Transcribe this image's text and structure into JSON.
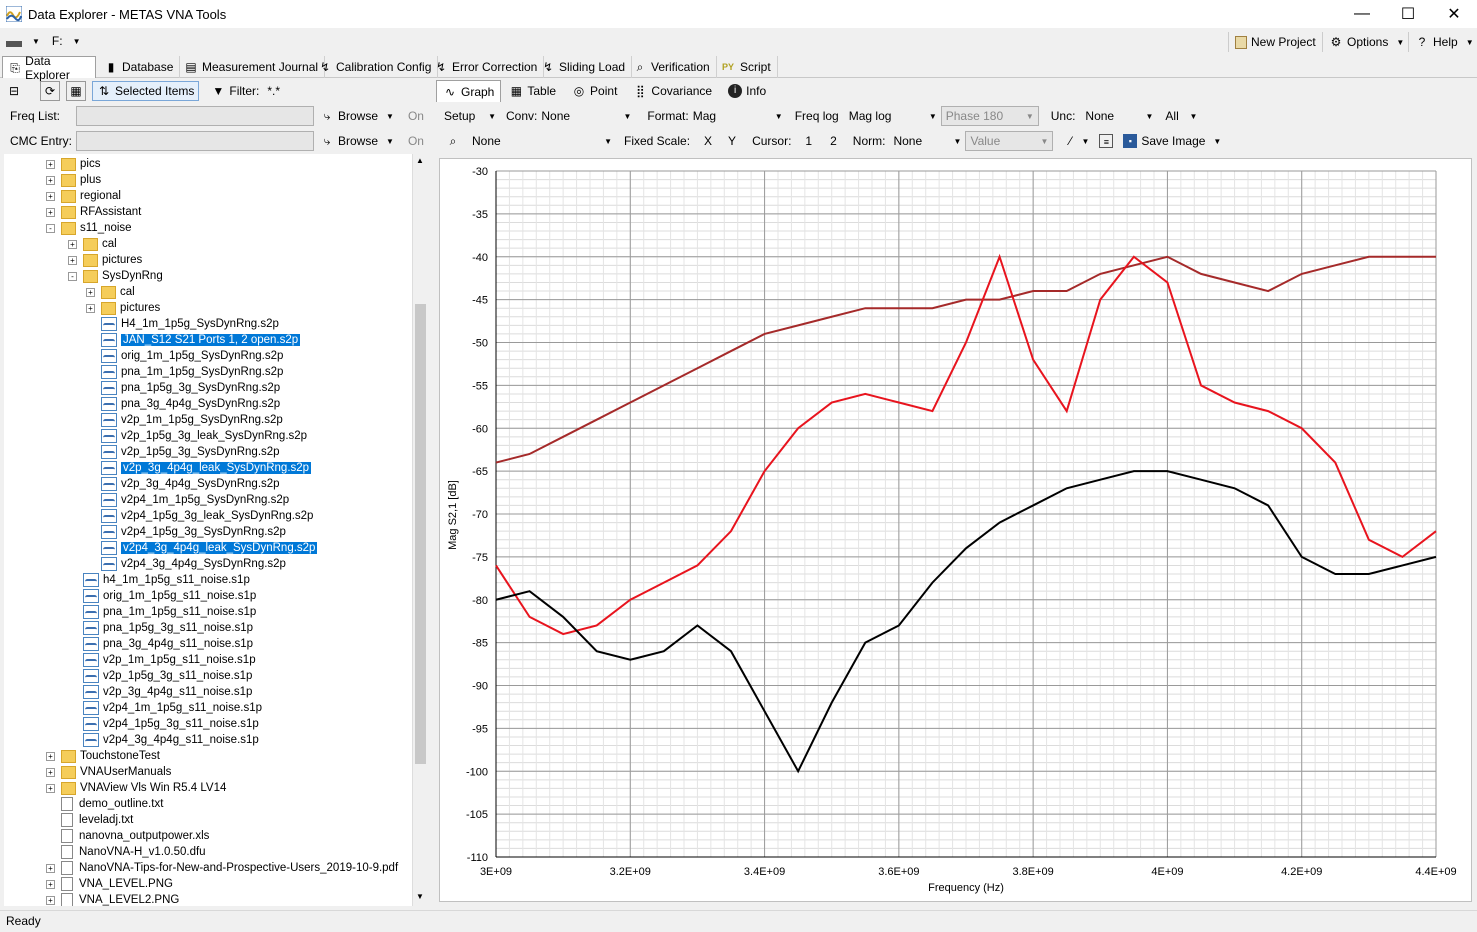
{
  "window": {
    "title": "Data Explorer - METAS VNA Tools",
    "minimize": "—",
    "maximize": "☐",
    "close": "✕"
  },
  "menubar": {
    "drive": "F:",
    "new_project": "New Project",
    "options": "Options",
    "help": "Help"
  },
  "top_tabs": [
    "Data Explorer",
    "Database",
    "Measurement Journal",
    "Calibration Config",
    "Error Correction",
    "Sliding Load",
    "Verification",
    "Script"
  ],
  "left_toolbar": {
    "selected_items": "Selected Items",
    "filter_label": "Filter:",
    "filter_value": "*.*",
    "freq_list_label": "Freq List:",
    "cmc_entry_label": "CMC Entry:",
    "browse": "Browse",
    "on": "On"
  },
  "tree": [
    {
      "label": "pics",
      "type": "folder",
      "level": 2,
      "expander": "+"
    },
    {
      "label": "plus",
      "type": "folder",
      "level": 2,
      "expander": "+"
    },
    {
      "label": "regional",
      "type": "folder",
      "level": 2,
      "expander": "+"
    },
    {
      "label": "RFAssistant",
      "type": "folder",
      "level": 2,
      "expander": "+"
    },
    {
      "label": "s11_noise",
      "type": "folder",
      "level": 2,
      "expander": "-"
    },
    {
      "label": "cal",
      "type": "folder",
      "level": 3,
      "expander": "+"
    },
    {
      "label": "pictures",
      "type": "folder",
      "level": 3,
      "expander": "+"
    },
    {
      "label": "SysDynRng",
      "type": "folder",
      "level": 3,
      "expander": "-"
    },
    {
      "label": "cal",
      "type": "folder",
      "level": 4,
      "expander": "+"
    },
    {
      "label": "pictures",
      "type": "folder",
      "level": 4,
      "expander": "+"
    },
    {
      "label": "H4_1m_1p5g_SysDynRng.s2p",
      "type": "s2p",
      "level": 4
    },
    {
      "label": "JAN_S12 S21 Ports 1, 2 open.s2p",
      "type": "s2p",
      "level": 4,
      "selected": true
    },
    {
      "label": "orig_1m_1p5g_SysDynRng.s2p",
      "type": "s2p",
      "level": 4
    },
    {
      "label": "pna_1m_1p5g_SysDynRng.s2p",
      "type": "s2p",
      "level": 4
    },
    {
      "label": "pna_1p5g_3g_SysDynRng.s2p",
      "type": "s2p",
      "level": 4
    },
    {
      "label": "pna_3g_4p4g_SysDynRng.s2p",
      "type": "s2p",
      "level": 4
    },
    {
      "label": "v2p_1m_1p5g_SysDynRng.s2p",
      "type": "s2p",
      "level": 4
    },
    {
      "label": "v2p_1p5g_3g_leak_SysDynRng.s2p",
      "type": "s2p",
      "level": 4
    },
    {
      "label": "v2p_1p5g_3g_SysDynRng.s2p",
      "type": "s2p",
      "level": 4
    },
    {
      "label": "v2p_3g_4p4g_leak_SysDynRng.s2p",
      "type": "s2p",
      "level": 4,
      "selected": true
    },
    {
      "label": "v2p_3g_4p4g_SysDynRng.s2p",
      "type": "s2p",
      "level": 4
    },
    {
      "label": "v2p4_1m_1p5g_SysDynRng.s2p",
      "type": "s2p",
      "level": 4
    },
    {
      "label": "v2p4_1p5g_3g_leak_SysDynRng.s2p",
      "type": "s2p",
      "level": 4
    },
    {
      "label": "v2p4_1p5g_3g_SysDynRng.s2p",
      "type": "s2p",
      "level": 4
    },
    {
      "label": "v2p4_3g_4p4g_leak_SysDynRng.s2p",
      "type": "s2p",
      "level": 4,
      "selected": true
    },
    {
      "label": "v2p4_3g_4p4g_SysDynRng.s2p",
      "type": "s2p",
      "level": 4
    },
    {
      "label": "h4_1m_1p5g_s11_noise.s1p",
      "type": "s1p",
      "level": 3
    },
    {
      "label": "orig_1m_1p5g_s11_noise.s1p",
      "type": "s1p",
      "level": 3
    },
    {
      "label": "pna_1m_1p5g_s11_noise.s1p",
      "type": "s1p",
      "level": 3
    },
    {
      "label": "pna_1p5g_3g_s11_noise.s1p",
      "type": "s1p",
      "level": 3
    },
    {
      "label": "pna_3g_4p4g_s11_noise.s1p",
      "type": "s1p",
      "level": 3
    },
    {
      "label": "v2p_1m_1p5g_s11_noise.s1p",
      "type": "s1p",
      "level": 3
    },
    {
      "label": "v2p_1p5g_3g_s11_noise.s1p",
      "type": "s1p",
      "level": 3
    },
    {
      "label": "v2p_3g_4p4g_s11_noise.s1p",
      "type": "s1p",
      "level": 3
    },
    {
      "label": "v2p4_1m_1p5g_s11_noise.s1p",
      "type": "s1p",
      "level": 3
    },
    {
      "label": "v2p4_1p5g_3g_s11_noise.s1p",
      "type": "s1p",
      "level": 3
    },
    {
      "label": "v2p4_3g_4p4g_s11_noise.s1p",
      "type": "s1p",
      "level": 3
    },
    {
      "label": "TouchstoneTest",
      "type": "folder",
      "level": 2,
      "expander": "+"
    },
    {
      "label": "VNAUserManuals",
      "type": "folder",
      "level": 2,
      "expander": "+"
    },
    {
      "label": "VNAView Vls Win R5.4 LV14",
      "type": "folder",
      "level": 2,
      "expander": "+"
    },
    {
      "label": "demo_outline.txt",
      "type": "file",
      "level": 2
    },
    {
      "label": "leveladj.txt",
      "type": "file",
      "level": 2
    },
    {
      "label": "nanovna_outputpower.xls",
      "type": "file",
      "level": 2
    },
    {
      "label": "NanoVNA-H_v1.0.50.dfu",
      "type": "file",
      "level": 2
    },
    {
      "label": "NanoVNA-Tips-for-New-and-Prospective-Users_2019-10-9.pdf",
      "type": "file",
      "level": 2,
      "expander": "+"
    },
    {
      "label": "VNA_LEVEL.PNG",
      "type": "file",
      "level": 2,
      "expander": "+"
    },
    {
      "label": "VNA_LEVEL2.PNG",
      "type": "file",
      "level": 2,
      "expander": "+"
    }
  ],
  "right_tabs": [
    "Graph",
    "Table",
    "Point",
    "Covariance",
    "Info"
  ],
  "graph_toolbar": {
    "setup": "Setup",
    "conv_label": "Conv:",
    "conv_value": "None",
    "format_label": "Format:",
    "format_value": "Mag",
    "freq_log": "Freq log",
    "mag_log": "Mag log",
    "phase": "Phase 180",
    "unc_label": "Unc:",
    "unc_value": "None",
    "all": "All",
    "search_value": "None",
    "fixed_scale_label": "Fixed Scale:",
    "x": "X",
    "y": "Y",
    "cursor_label": "Cursor:",
    "cursor1": "1",
    "cursor2": "2",
    "norm_label": "Norm:",
    "norm_value": "None",
    "value_placeholder": "Value",
    "save_image": "Save Image"
  },
  "status": "Ready",
  "chart_data": {
    "type": "line",
    "xlabel": "Frequency (Hz)",
    "ylabel": "Mag S2,1 [dB]",
    "xlim": [
      3000000000,
      4400000000
    ],
    "ylim": [
      -110,
      -30
    ],
    "x_ticks": [
      "3E+09",
      "3.2E+09",
      "3.4E+09",
      "3.6E+09",
      "3.8E+09",
      "4E+09",
      "4.2E+09",
      "4.4E+09"
    ],
    "y_ticks": [
      "-30",
      "-35",
      "-40",
      "-45",
      "-50",
      "-55",
      "-60",
      "-65",
      "-70",
      "-75",
      "-80",
      "-85",
      "-90",
      "-95",
      "-100",
      "-105",
      "-110"
    ],
    "grid": true,
    "series": [
      {
        "color": "#a52a2a",
        "x": [
          3000000000.0,
          3050000000.0,
          3100000000.0,
          3150000000.0,
          3200000000.0,
          3250000000.0,
          3300000000.0,
          3350000000.0,
          3400000000.0,
          3450000000.0,
          3500000000.0,
          3550000000.0,
          3600000000.0,
          3650000000.0,
          3700000000.0,
          3750000000.0,
          3800000000.0,
          3850000000.0,
          3900000000.0,
          3950000000.0,
          4000000000.0,
          4050000000.0,
          4100000000.0,
          4150000000.0,
          4200000000.0,
          4250000000.0,
          4300000000.0,
          4350000000.0,
          4400000000.0
        ],
        "values": [
          -64,
          -63,
          -61,
          -59,
          -57,
          -55,
          -53,
          -51,
          -49,
          -48,
          -47,
          -46,
          -46,
          -46,
          -45,
          -45,
          -44,
          -44,
          -42,
          -41,
          -40,
          -42,
          -43,
          -44,
          -42,
          -41,
          -40,
          -40,
          -40
        ]
      },
      {
        "color": "#e8141e",
        "x": [
          3000000000.0,
          3050000000.0,
          3100000000.0,
          3150000000.0,
          3200000000.0,
          3250000000.0,
          3300000000.0,
          3350000000.0,
          3400000000.0,
          3450000000.0,
          3500000000.0,
          3550000000.0,
          3600000000.0,
          3650000000.0,
          3700000000.0,
          3750000000.0,
          3800000000.0,
          3850000000.0,
          3900000000.0,
          3950000000.0,
          4000000000.0,
          4050000000.0,
          4100000000.0,
          4150000000.0,
          4200000000.0,
          4250000000.0,
          4300000000.0,
          4350000000.0,
          4400000000.0
        ],
        "values": [
          -76,
          -82,
          -84,
          -83,
          -80,
          -78,
          -76,
          -72,
          -65,
          -60,
          -57,
          -56,
          -57,
          -58,
          -50,
          -40,
          -52,
          -58,
          -45,
          -40,
          -43,
          -55,
          -57,
          -58,
          -60,
          -64,
          -73,
          -75,
          -72
        ]
      },
      {
        "color": "#000000",
        "x": [
          3000000000.0,
          3050000000.0,
          3100000000.0,
          3150000000.0,
          3200000000.0,
          3250000000.0,
          3300000000.0,
          3350000000.0,
          3400000000.0,
          3450000000.0,
          3500000000.0,
          3550000000.0,
          3600000000.0,
          3650000000.0,
          3700000000.0,
          3750000000.0,
          3800000000.0,
          3850000000.0,
          3900000000.0,
          3950000000.0,
          4000000000.0,
          4050000000.0,
          4100000000.0,
          4150000000.0,
          4200000000.0,
          4250000000.0,
          4300000000.0,
          4350000000.0,
          4400000000.0
        ],
        "values": [
          -80,
          -79,
          -82,
          -86,
          -87,
          -86,
          -83,
          -86,
          -93,
          -100,
          -92,
          -85,
          -83,
          -78,
          -74,
          -71,
          -69,
          -67,
          -66,
          -65,
          -65,
          -66,
          -67,
          -69,
          -75,
          -77,
          -77,
          -76,
          -75
        ]
      }
    ]
  }
}
